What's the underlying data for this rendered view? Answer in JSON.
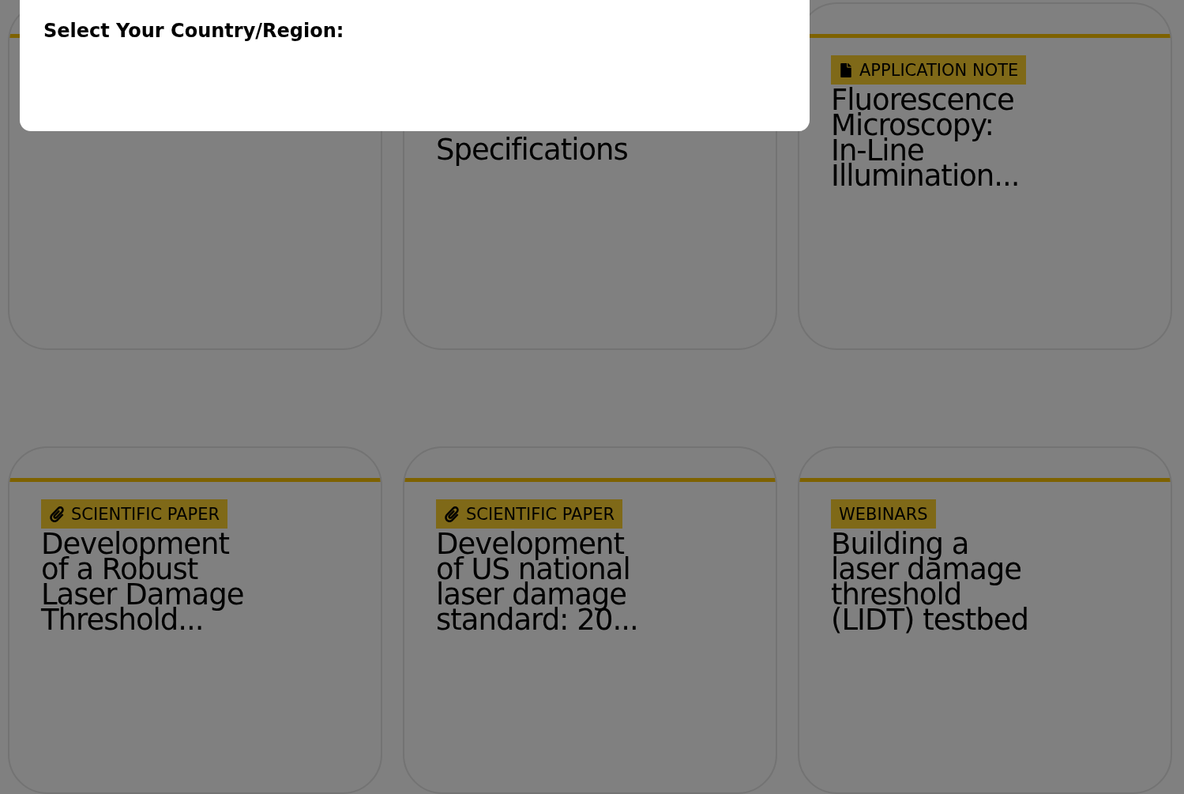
{
  "dialog": {
    "title": "Select Your Country/Region:"
  },
  "cards": [
    {
      "kind": "covered"
    },
    {
      "kind": "covered",
      "title": "Specifications"
    },
    {
      "kind": "teaser",
      "badge": {
        "kind": "document",
        "label": "APPLICATION NOTE"
      },
      "title": "Fluorescence\nMicroscopy:\nIn-Line\nIllumination..."
    },
    {
      "kind": "teaser",
      "badge": {
        "kind": "paper",
        "label": "SCIENTIFIC PAPER"
      },
      "title": "Development\nof a Robust\nLaser Damage\nThreshold..."
    },
    {
      "kind": "teaser",
      "badge": {
        "kind": "paper",
        "label": "SCIENTIFIC PAPER"
      },
      "title": "Development\nof US national\nlaser damage\nstandard: 20..."
    },
    {
      "kind": "teaser",
      "badge": {
        "kind": "none",
        "label": "WEBINARS"
      },
      "title": "Building a\nlaser damage\nthreshold\n(LIDT) testbed"
    }
  ]
}
